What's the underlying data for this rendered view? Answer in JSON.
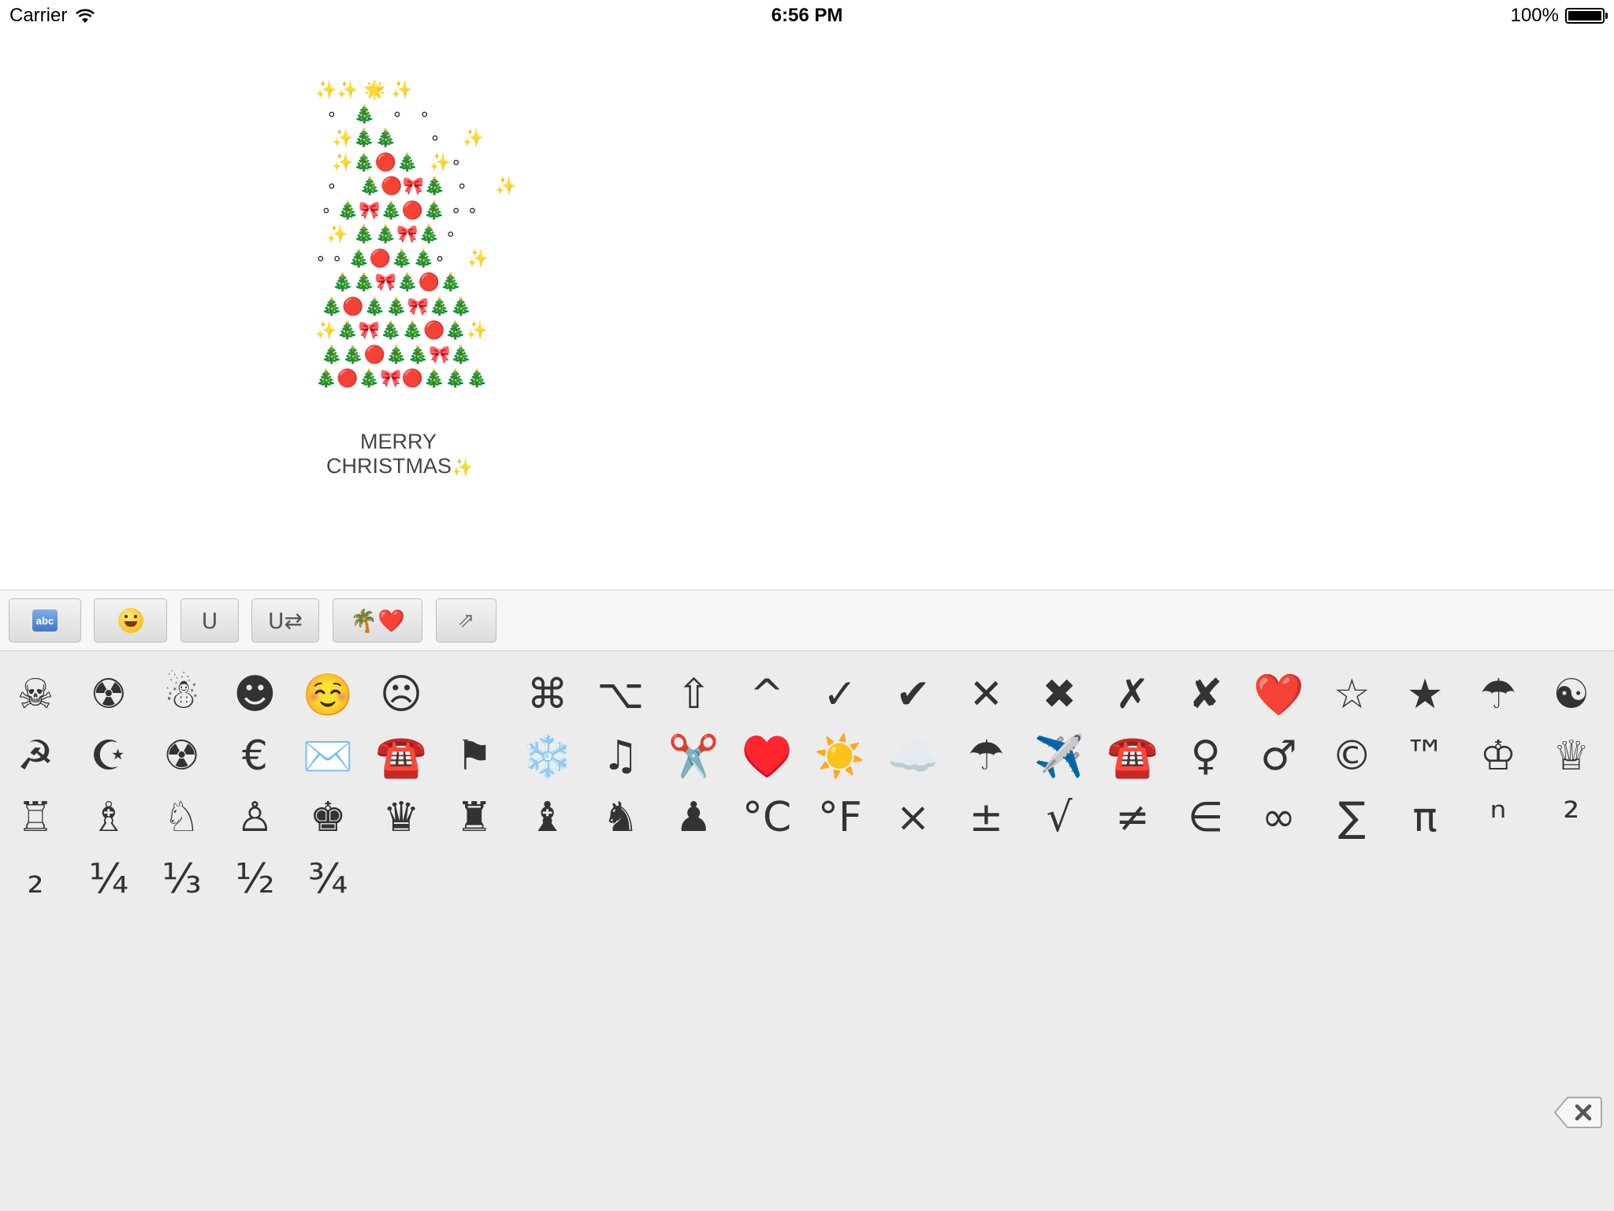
{
  "status": {
    "carrier": "Carrier",
    "time": "6:56 PM",
    "battery": "100%",
    "battery_level": 1.0
  },
  "text_area": {
    "tree_lines": [
      "✨✨ 🌟 ✨",
      "  ∘   🎄   ∘   ∘",
      "   ✨🎄🎄      ∘    ✨",
      "   ✨🎄🔴🎄  ✨∘",
      "  ∘    🎄🔴🎀🎄  ∘     ✨",
      " ∘ 🎄🎀🎄🔴🎄 ∘ ∘",
      "  ✨ 🎄🎄🎀🎄 ∘",
      "∘ ∘ 🎄🔴🎄🎄∘    ✨",
      "   🎄🎄🎀🎄🔴🎄",
      " 🎄🔴🎄🎄🎀🎄🎄",
      "✨🎄🎀🎄🎄🔴🎄✨",
      " 🎄🎄🔴🎄🎄🎀🎄",
      "🎄🔴🎄🎀🔴🎄🎄🎄"
    ],
    "greeting_line1": "MERRY",
    "greeting_line2": "CHRISTMAS",
    "greeting_spark": "✨"
  },
  "toolbar": {
    "buttons": [
      {
        "id": "abc",
        "label": "abc"
      },
      {
        "id": "emoji",
        "label": ""
      },
      {
        "id": "unicode",
        "label": "U"
      },
      {
        "id": "unicode-convert",
        "label": "U⇄"
      },
      {
        "id": "favorites",
        "label": "🌴❤️"
      },
      {
        "id": "expand",
        "label": "⇗"
      }
    ]
  },
  "keyboard": {
    "rows": [
      [
        "☠",
        "☢",
        "☃",
        "☻",
        "☺️",
        "☹",
        "",
        "⌘",
        "⌥",
        "⇧",
        "^",
        "✓",
        "✔",
        "✕",
        "✖",
        "✗",
        "✘",
        "❤️",
        "☆",
        "★",
        "☂",
        "☯"
      ],
      [
        "☭",
        "☪",
        "☢",
        "€",
        "✉️",
        "☎️",
        "⚑",
        "❄️",
        "♫",
        "✂️",
        "♥️",
        "☀️",
        "☁️",
        "☂",
        "✈️",
        "☎️",
        "♀",
        "♂",
        "©",
        "™",
        "♔",
        "♕"
      ],
      [
        "♖",
        "♗",
        "♘",
        "♙",
        "♚",
        "♛",
        "♜",
        "♝",
        "♞",
        "♟",
        "°C",
        "°F",
        "×",
        "±",
        "√",
        "≠",
        "∈",
        "∞",
        "∑",
        "π",
        "ⁿ",
        "²"
      ],
      [
        "₂",
        "¼",
        "⅓",
        "½",
        "¾"
      ]
    ],
    "delete_label": "✕"
  }
}
